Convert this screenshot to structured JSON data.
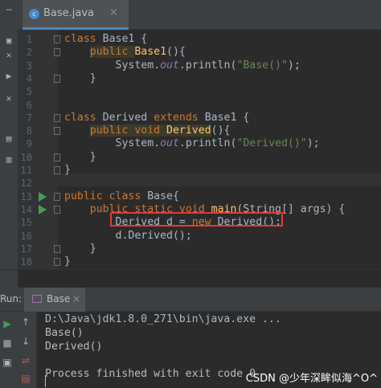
{
  "tab": {
    "label": "Base.java",
    "close": "×",
    "icon_letter": "c"
  },
  "code_lines": [
    {
      "num": "1",
      "segments": [
        {
          "t": "class ",
          "c": "kw"
        },
        {
          "t": "Base1 {",
          "c": ""
        }
      ]
    },
    {
      "num": "2",
      "segments": [
        {
          "t": "    ",
          "c": ""
        },
        {
          "t": "public ",
          "c": "kw hl"
        },
        {
          "t": "Base1",
          "c": "fn"
        },
        {
          "t": "(){",
          "c": ""
        }
      ]
    },
    {
      "num": "3",
      "segments": [
        {
          "t": "        System.",
          "c": ""
        },
        {
          "t": "out",
          "c": "it"
        },
        {
          "t": ".println(",
          "c": ""
        },
        {
          "t": "\"Base()\"",
          "c": "str"
        },
        {
          "t": ");",
          "c": ""
        }
      ]
    },
    {
      "num": "4",
      "segments": [
        {
          "t": "    }",
          "c": ""
        }
      ]
    },
    {
      "num": "5",
      "segments": []
    },
    {
      "num": "6",
      "segments": []
    },
    {
      "num": "7",
      "segments": [
        {
          "t": "class ",
          "c": "kw"
        },
        {
          "t": "Derived ",
          "c": ""
        },
        {
          "t": "extends ",
          "c": "kw"
        },
        {
          "t": "Base1 {",
          "c": ""
        }
      ]
    },
    {
      "num": "8",
      "segments": [
        {
          "t": "    ",
          "c": ""
        },
        {
          "t": "public void ",
          "c": "kw hl"
        },
        {
          "t": "Derived",
          "c": "fn hl"
        },
        {
          "t": "(){",
          "c": ""
        }
      ]
    },
    {
      "num": "9",
      "segments": [
        {
          "t": "        System.",
          "c": ""
        },
        {
          "t": "out",
          "c": "it"
        },
        {
          "t": ".println(",
          "c": ""
        },
        {
          "t": "\"Derived()\"",
          "c": "str"
        },
        {
          "t": ");",
          "c": ""
        }
      ]
    },
    {
      "num": "10",
      "segments": [
        {
          "t": "    }",
          "c": ""
        }
      ]
    },
    {
      "num": "11",
      "segments": [
        {
          "t": "}",
          "c": ""
        }
      ]
    },
    {
      "num": "12",
      "segments": []
    },
    {
      "num": "13",
      "segments": [
        {
          "t": "public class ",
          "c": "kw"
        },
        {
          "t": "Base{",
          "c": ""
        }
      ]
    },
    {
      "num": "14",
      "segments": [
        {
          "t": "    ",
          "c": ""
        },
        {
          "t": "public static void ",
          "c": "kw"
        },
        {
          "t": "main",
          "c": "fn"
        },
        {
          "t": "(String[] args) {",
          "c": ""
        }
      ]
    },
    {
      "num": "15",
      "segments": [
        {
          "t": "        Derived d = ",
          "c": ""
        },
        {
          "t": "new ",
          "c": "kw"
        },
        {
          "t": "Derived();",
          "c": ""
        }
      ]
    },
    {
      "num": "16",
      "segments": [
        {
          "t": "        d.Derived();",
          "c": ""
        }
      ]
    },
    {
      "num": "17",
      "segments": [
        {
          "t": "    }",
          "c": ""
        }
      ]
    },
    {
      "num": "18",
      "segments": [
        {
          "t": "}",
          "c": ""
        }
      ]
    }
  ],
  "run_panel": {
    "label": "Run:",
    "tab_label": "Base",
    "tab_close": "×",
    "console_lines": [
      "D:\\Java\\jdk1.8.0_271\\bin\\java.exe ...",
      "Base()",
      "Derived()",
      "",
      "Process finished with exit code 0"
    ]
  },
  "watermark": "CSDN @少年深眸似海^O^",
  "colors": {
    "background": "#2b2b2b",
    "keyword": "#cc7832",
    "method": "#ffc66d",
    "string": "#6a8759",
    "highlight_box": "#e53935",
    "run_arrow": "#499c54"
  }
}
